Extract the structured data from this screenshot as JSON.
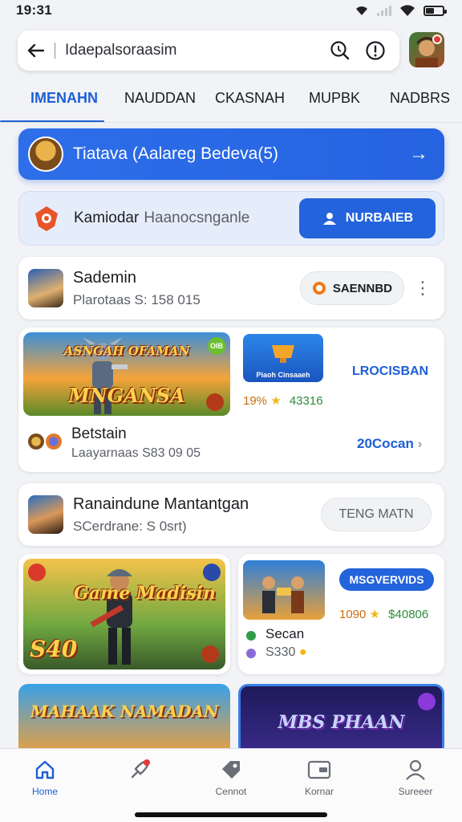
{
  "status": {
    "time": "19:31"
  },
  "search": {
    "query": "Idaepalsoraasim"
  },
  "tabs": [
    "IMENAHN",
    "NAUDDAN",
    "CKASNAH",
    "MUPBK",
    "NADBRS"
  ],
  "banner": {
    "text": "Tiatava (Aalareg Bedeva(5)"
  },
  "info_bar": {
    "label": "Kamiodar",
    "sub": "Haanocsnganle",
    "button": "NURBAIEB"
  },
  "players": [
    {
      "name": "Sademin",
      "info": "Plarotaas  S: 158 015",
      "action": "SAENNBD"
    },
    {
      "name": "Ranaindune Mantantgan",
      "info": "SCerdrane: S 0srt)",
      "action": "TENG MATN"
    }
  ],
  "game_cards": [
    {
      "art_title_top": "ASNGAH OFAMAN",
      "art_title": "MNGANSA",
      "badge": "OIB",
      "thumb_text": "Piaoh Cinsaaeh",
      "side_label": "LROCISBAN",
      "rating_pct": "19%",
      "rating_count": "43316",
      "name": "Betstain",
      "info": "Laayarnaas S83 09 05",
      "link": "20Cocan"
    },
    {
      "art_title": "Game Madisin",
      "art_price": "S40",
      "tag": "MSGVERVIDS",
      "rating_pct": "1090",
      "rating_count": "$40806",
      "name": "Secan",
      "info": "S330"
    }
  ],
  "peek_cards": [
    {
      "title": "MAHAAK NAMADAN"
    },
    {
      "title": "MBS PHAAN"
    }
  ],
  "bottom_nav": [
    {
      "label": "Home",
      "icon": "home-icon",
      "active": true
    },
    {
      "label": "",
      "icon": "rocket-icon",
      "active": false
    },
    {
      "label": "Cennot",
      "icon": "tag-icon",
      "active": false
    },
    {
      "label": "Kornar",
      "icon": "wallet-icon",
      "active": false
    },
    {
      "label": "Sureeer",
      "icon": "profile-icon",
      "active": false
    }
  ],
  "colors": {
    "accent": "#1d5fd6",
    "primary_button": "#2363db",
    "badge_red": "#e53935"
  }
}
